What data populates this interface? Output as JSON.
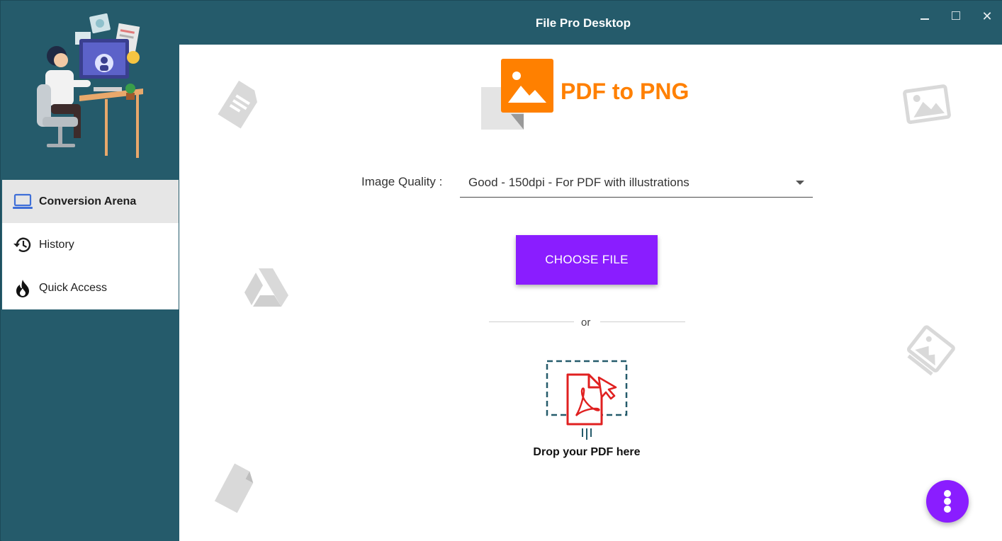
{
  "window": {
    "title": "File Pro Desktop",
    "controls": {
      "minimize": "minimize",
      "maximize": "maximize",
      "close": "✕"
    }
  },
  "sidebar": {
    "items": [
      {
        "label": "Conversion Arena",
        "icon": "laptop-icon",
        "active": true
      },
      {
        "label": "History",
        "icon": "history-icon",
        "active": false
      },
      {
        "label": "Quick Access",
        "icon": "flame-icon",
        "active": false
      }
    ]
  },
  "main": {
    "logo_text": "PDF to PNG",
    "quality_label": "Image Quality :",
    "quality_value": "Good - 150dpi - For PDF with illustrations",
    "choose_button": "CHOOSE FILE",
    "or_text": "or",
    "drop_text": "Drop your PDF here"
  },
  "colors": {
    "sidebar_bg": "#255b6b",
    "accent_purple": "#8a1dff",
    "brand_orange": "#ff8000",
    "pdf_red": "#e02020"
  }
}
